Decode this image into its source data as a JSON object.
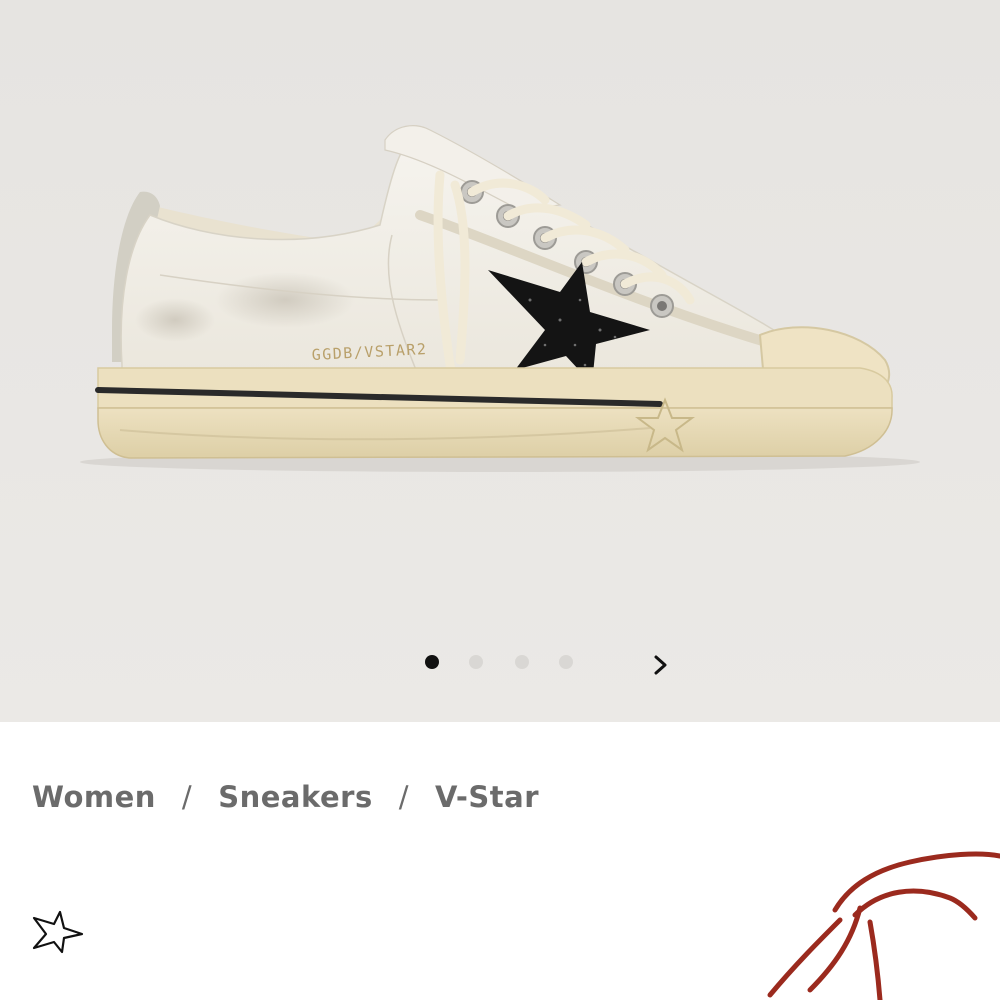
{
  "gallery": {
    "product_image": "shoe-photo",
    "slide_count": 4,
    "active_slide": 1,
    "next_icon": "chevron-right-icon",
    "colors": {
      "background": "#e9e7e4",
      "dot_active": "#111111",
      "dot_inactive": "#d9d7d4"
    },
    "shoe_logo": "GGDB/VSTAR2"
  },
  "breadcrumb": {
    "items": [
      "Women",
      "Sneakers",
      "V-Star"
    ],
    "separator": "/"
  },
  "wishlist": {
    "icon": "star-outline-icon"
  },
  "annotation": {
    "icon": "scribble-mark",
    "color": "#9b2a1e"
  }
}
